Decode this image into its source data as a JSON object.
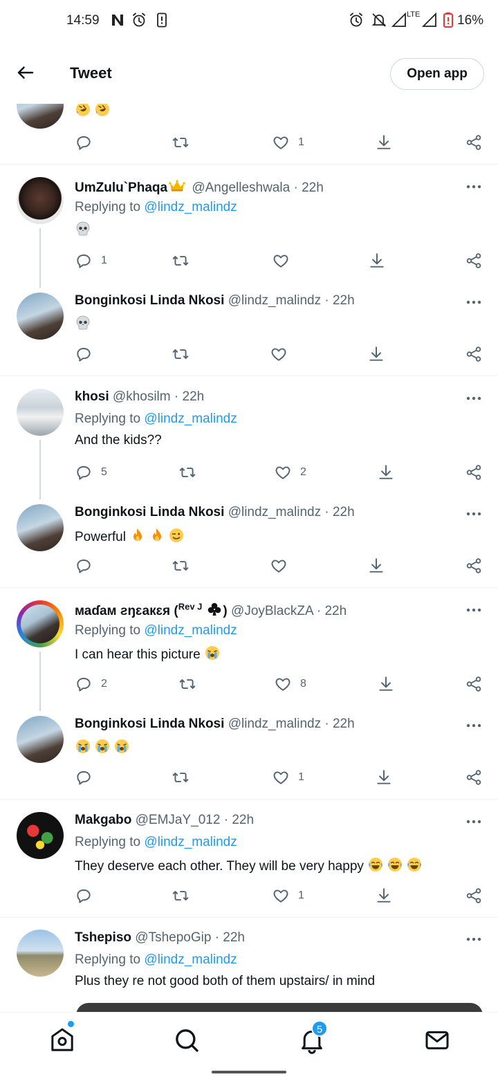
{
  "status_bar": {
    "time": "14:59",
    "battery": "16%"
  },
  "header": {
    "title": "Tweet",
    "open_app": "Open app"
  },
  "top_partial": {
    "likes": "1"
  },
  "tweets": [
    {
      "name": "UmZulu`Phaqa",
      "handle": "@Angelleshwala",
      "dot": "·",
      "time": "22h",
      "replying": "Replying to",
      "reply_to": "@lindz_malindz",
      "text": "",
      "replies": "1",
      "retweets": "",
      "likes": ""
    },
    {
      "name": "Bonginkosi Linda Nkosi",
      "handle": "@lindz_malindz",
      "dot": "·",
      "time": "22h",
      "text": "",
      "replies": "",
      "retweets": "",
      "likes": ""
    },
    {
      "name": "khosi",
      "handle": "@khosilm",
      "dot": "·",
      "time": "22h",
      "replying": "Replying to",
      "reply_to": "@lindz_malindz",
      "text": "And the kids??",
      "replies": "5",
      "retweets": "",
      "likes": "2"
    },
    {
      "name": "Bonginkosi Linda Nkosi",
      "handle": "@lindz_malindz",
      "dot": "·",
      "time": "22h",
      "text": "Powerful",
      "replies": "",
      "retweets": "",
      "likes": ""
    },
    {
      "name": "маɗам ƨŋɛакɛя (",
      "name_sup": "Rev J",
      "name_close": ")",
      "handle": "@JoyBlackZA",
      "dot": "·",
      "time": "22h",
      "replying": "Replying to",
      "reply_to": "@lindz_malindz",
      "text": "I can hear this picture",
      "replies": "2",
      "retweets": "",
      "likes": "8"
    },
    {
      "name": "Bonginkosi Linda Nkosi",
      "handle": "@lindz_malindz",
      "dot": "·",
      "time": "22h",
      "text": "",
      "replies": "",
      "retweets": "",
      "likes": "1"
    },
    {
      "name": "Makgabo",
      "handle": "@EMJaY_012",
      "dot": "·",
      "time": "22h",
      "replying": "Replying to",
      "reply_to": "@lindz_malindz",
      "text": "They deserve each other. They will be very happy",
      "replies": "",
      "retweets": "",
      "likes": "1"
    },
    {
      "name": "Tshepiso",
      "handle": "@TshepoGip",
      "dot": "·",
      "time": "22h",
      "replying": "Replying to",
      "reply_to": "@lindz_malindz",
      "text": "Plus they re not good both of them upstairs/ in mind"
    }
  ],
  "bottom_nav": {
    "notifications_badge": "5"
  },
  "icons": [
    "back-arrow-icon",
    "reply-icon",
    "retweet-icon",
    "like-icon",
    "download-icon",
    "share-icon",
    "more-icon",
    "home-icon",
    "search-icon",
    "bell-icon",
    "mail-icon"
  ],
  "colors": {
    "link": "#1d9bf0",
    "secondary": "#536471",
    "text": "#0f1419"
  }
}
